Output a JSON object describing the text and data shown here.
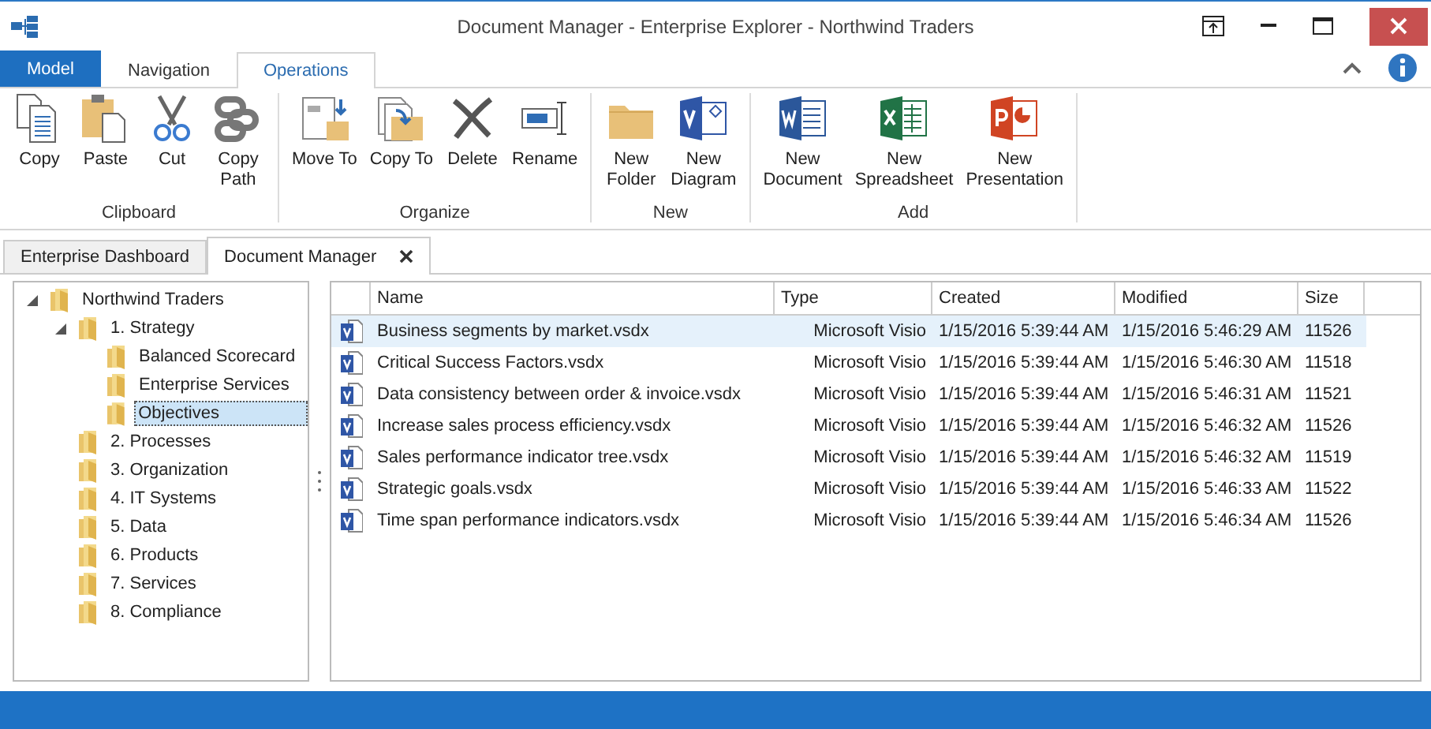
{
  "window": {
    "title": "Document Manager - Enterprise Explorer - Northwind Traders"
  },
  "ribbon_tabs": [
    {
      "label": "Model",
      "kind": "app"
    },
    {
      "label": "Navigation",
      "kind": "tab",
      "selected": false
    },
    {
      "label": "Operations",
      "kind": "tab",
      "selected": true
    }
  ],
  "ribbon_groups": [
    {
      "label": "Clipboard",
      "buttons": [
        "Copy",
        "Paste",
        "Cut",
        "Copy\nPath"
      ]
    },
    {
      "label": "Organize",
      "buttons": [
        "Move To",
        "Copy To",
        "Delete",
        "Rename"
      ]
    },
    {
      "label": "New",
      "buttons": [
        "New\nFolder",
        "New\nDiagram"
      ]
    },
    {
      "label": "Add",
      "buttons": [
        "New\nDocument",
        "New\nSpreadsheet",
        "New\nPresentation"
      ]
    }
  ],
  "document_tabs": [
    {
      "label": "Enterprise Dashboard",
      "selected": false,
      "closable": false
    },
    {
      "label": "Document Manager",
      "selected": true,
      "closable": true
    }
  ],
  "tree": [
    {
      "label": "Northwind Traders",
      "selected": false,
      "expanded": true,
      "children": [
        {
          "label": "1. Strategy",
          "selected": false,
          "expanded": true,
          "children": [
            {
              "label": "Balanced Scorecard",
              "selected": false
            },
            {
              "label": "Enterprise Services",
              "selected": false
            },
            {
              "label": "Objectives",
              "selected": true
            }
          ]
        },
        {
          "label": "2. Processes",
          "selected": false
        },
        {
          "label": "3. Organization",
          "selected": false
        },
        {
          "label": "4. IT Systems",
          "selected": false
        },
        {
          "label": "5. Data",
          "selected": false
        },
        {
          "label": "6. Products",
          "selected": false
        },
        {
          "label": "7. Services",
          "selected": false
        },
        {
          "label": "8. Compliance",
          "selected": false
        }
      ]
    }
  ],
  "table": {
    "columns": [
      "Name",
      "Type",
      "Created",
      "Modified",
      "Size"
    ],
    "rows": [
      {
        "selected": true,
        "cells": [
          "Business segments by market.vsdx",
          "Microsoft Visio",
          "1/15/2016 5:39:44 AM",
          "1/15/2016 5:46:29 AM",
          "11526"
        ]
      },
      {
        "selected": false,
        "cells": [
          "Critical Success Factors.vsdx",
          "Microsoft Visio",
          "1/15/2016 5:39:44 AM",
          "1/15/2016 5:46:30 AM",
          "11518"
        ]
      },
      {
        "selected": false,
        "cells": [
          "Data consistency between order & invoice.vsdx",
          "Microsoft Visio",
          "1/15/2016 5:39:44 AM",
          "1/15/2016 5:46:31 AM",
          "11521"
        ]
      },
      {
        "selected": false,
        "cells": [
          "Increase sales process efficiency.vsdx",
          "Microsoft Visio",
          "1/15/2016 5:39:44 AM",
          "1/15/2016 5:46:32 AM",
          "11526"
        ]
      },
      {
        "selected": false,
        "cells": [
          "Sales performance indicator tree.vsdx",
          "Microsoft Visio",
          "1/15/2016 5:39:44 AM",
          "1/15/2016 5:46:32 AM",
          "11519"
        ]
      },
      {
        "selected": false,
        "cells": [
          "Strategic goals.vsdx",
          "Microsoft Visio",
          "1/15/2016 5:39:44 AM",
          "1/15/2016 5:46:33 AM",
          "11522"
        ]
      },
      {
        "selected": false,
        "cells": [
          "Time span performance indicators.vsdx",
          "Microsoft Visio",
          "1/15/2016 5:39:44 AM",
          "1/15/2016 5:46:34 AM",
          "11526"
        ]
      }
    ]
  }
}
